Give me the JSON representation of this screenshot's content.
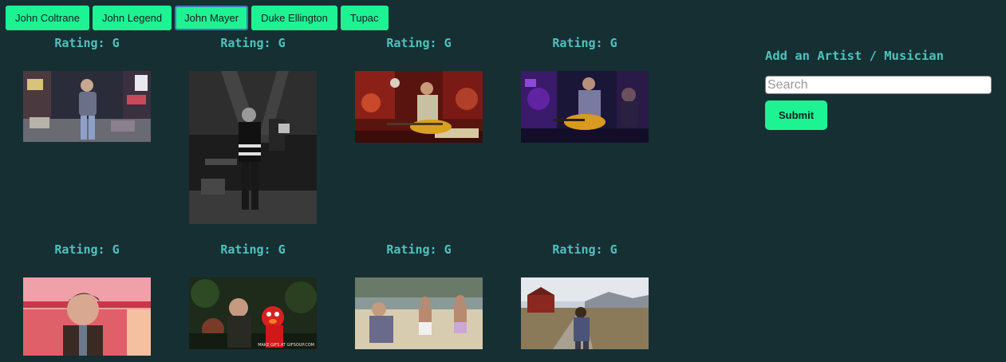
{
  "artists": [
    "John Coltrane",
    "John Legend",
    "John Mayer",
    "Duke Ellington",
    "Tupac"
  ],
  "active_artist": "John Mayer",
  "gifs": [
    {
      "rating": "Rating: G",
      "scene": "times-square-walking"
    },
    {
      "rating": "Rating: G",
      "scene": "black-white-stage-performance"
    },
    {
      "rating": "Rating: G",
      "scene": "guitarist-on-stage-red"
    },
    {
      "rating": "Rating: G",
      "scene": "guitarist-on-stage-purple"
    },
    {
      "rating": "Rating: G",
      "scene": "man-closeup-pink-set"
    },
    {
      "rating": "Rating: G",
      "scene": "man-with-elmo"
    },
    {
      "rating": "Rating: G",
      "scene": "beach-men-walking"
    },
    {
      "rating": "Rating: G",
      "scene": "farm-road-red-barn"
    }
  ],
  "gif_watermark": "MAKE GIFS AT GIFSOUP.COM",
  "sidebar": {
    "heading": "Add an Artist / Musician",
    "search_placeholder": "Search",
    "submit_label": "Submit"
  },
  "colors": {
    "background": "#162f33",
    "accent": "#1ef393",
    "heading": "#4fc2be"
  }
}
